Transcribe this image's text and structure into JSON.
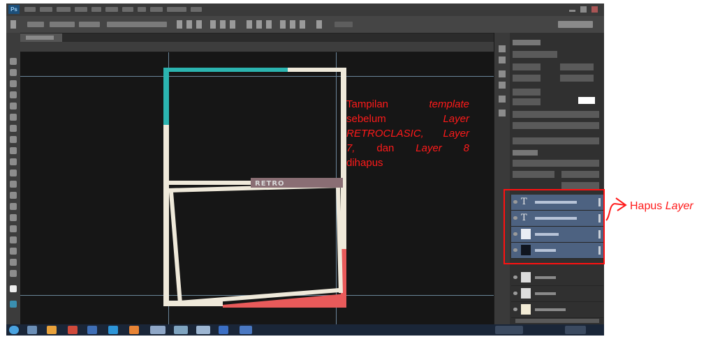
{
  "annotation": {
    "w1": "Tampilan",
    "w2": "template",
    "w3": "sebelum",
    "w4": "Layer",
    "w5": "RETROCLASIC, Layer",
    "w6": "7,",
    "w7": "dan",
    "w8": "Layer 8",
    "w9": "dihapus",
    "color": "#ff1a1a"
  },
  "callout": {
    "prefix": "Hapus",
    "emph": "Layer"
  },
  "app": {
    "logo": "Ps"
  },
  "canvas": {
    "banner_text": "RETRO"
  },
  "colors": {
    "teal": "#2bb4b0",
    "cream": "#efe9da",
    "coral": "#e85a5a",
    "selection": "#4d6281"
  },
  "layers": {
    "layer_type_icon": "T"
  }
}
